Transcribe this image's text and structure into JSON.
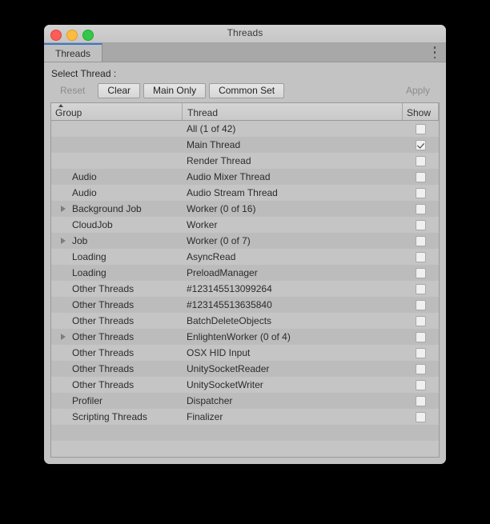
{
  "window": {
    "title": "Threads",
    "traffic_lights": [
      "close-button",
      "minimize-button",
      "zoom-button"
    ]
  },
  "tabs": [
    {
      "label": "Threads",
      "active": true
    }
  ],
  "kebab_menu_label": "⋮",
  "panel": {
    "select_label": "Select Thread :"
  },
  "toolbar": {
    "reset_label": "Reset",
    "clear_label": "Clear",
    "main_only_label": "Main Only",
    "common_set_label": "Common Set",
    "apply_label": "Apply"
  },
  "table": {
    "headers": {
      "group": "Group",
      "thread": "Thread",
      "show": "Show"
    },
    "sort_column": "Group",
    "sort_direction": "ascending",
    "rows": [
      {
        "group": "",
        "thread": "All (1 of 42)",
        "show": false,
        "twisty": "open"
      },
      {
        "group": "",
        "thread": "Main Thread",
        "show": true,
        "twisty": "none"
      },
      {
        "group": "",
        "thread": "Render Thread",
        "show": false,
        "twisty": "none"
      },
      {
        "group": "Audio",
        "thread": "Audio Mixer Thread",
        "show": false,
        "twisty": "none"
      },
      {
        "group": "Audio",
        "thread": "Audio Stream Thread",
        "show": false,
        "twisty": "none"
      },
      {
        "group": "Background Job",
        "thread": "Worker (0 of 16)",
        "show": false,
        "twisty": "closed"
      },
      {
        "group": "CloudJob",
        "thread": "Worker",
        "show": false,
        "twisty": "none"
      },
      {
        "group": "Job",
        "thread": "Worker (0 of 7)",
        "show": false,
        "twisty": "closed"
      },
      {
        "group": "Loading",
        "thread": "AsyncRead",
        "show": false,
        "twisty": "none"
      },
      {
        "group": "Loading",
        "thread": "PreloadManager",
        "show": false,
        "twisty": "none"
      },
      {
        "group": "Other Threads",
        "thread": "#123145513099264",
        "show": false,
        "twisty": "none"
      },
      {
        "group": "Other Threads",
        "thread": "#123145513635840",
        "show": false,
        "twisty": "none"
      },
      {
        "group": "Other Threads",
        "thread": "BatchDeleteObjects",
        "show": false,
        "twisty": "none"
      },
      {
        "group": "Other Threads",
        "thread": "EnlightenWorker (0 of 4)",
        "show": false,
        "twisty": "closed"
      },
      {
        "group": "Other Threads",
        "thread": "OSX HID Input",
        "show": false,
        "twisty": "none"
      },
      {
        "group": "Other Threads",
        "thread": "UnitySocketReader",
        "show": false,
        "twisty": "none"
      },
      {
        "group": "Other Threads",
        "thread": "UnitySocketWriter",
        "show": false,
        "twisty": "none"
      },
      {
        "group": "Profiler",
        "thread": "Dispatcher",
        "show": false,
        "twisty": "none"
      },
      {
        "group": "Scripting Threads",
        "thread": "Finalizer",
        "show": false,
        "twisty": "none"
      },
      {
        "group": "",
        "thread": "",
        "show": null,
        "twisty": "none"
      },
      {
        "group": "",
        "thread": "",
        "show": null,
        "twisty": "none"
      }
    ]
  },
  "colors": {
    "accent": "#3c78c8",
    "window_bg": "#c3c3c3",
    "row_odd": "#c5c5c5",
    "row_even": "#bcbcbc"
  }
}
